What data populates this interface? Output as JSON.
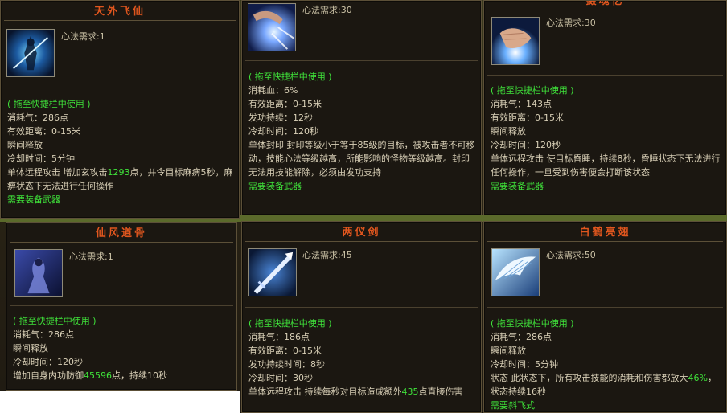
{
  "common": {
    "drag_hint": "( 拖至快捷栏中使用 )",
    "need_weapon": "需要装备武器"
  },
  "cards": [
    {
      "title": "天外飞仙",
      "req": "心法需求:1",
      "icon": "blue-sword-figure-icon",
      "lines": [
        "消耗气：286点",
        "有效距离：0-15米",
        "瞬间释放",
        "冷却时间：5分钟"
      ],
      "desc_pre": "单体远程攻击 增加玄攻击",
      "desc_num": "1293",
      "desc_post": "点，并令目标麻痹5秒，麻痹状态下无法进行任何操作",
      "footer": "需要装备武器"
    },
    {
      "title": "",
      "req": "心法需求:30",
      "icon": "glowing-hand-icon",
      "lines": [
        "消耗血：6%",
        "有效距离：0-15米",
        "发功持续：12秒",
        "冷却时间：120秒"
      ],
      "desc_pre": "单体封印 封印等级小于等于85级的目标，被攻击者不可移动，技能心法等级越高，所能影响的怪物等级越高。封印无法用技能解除，必须由发功支持",
      "desc_num": "",
      "desc_post": "",
      "footer": "需要装备武器"
    },
    {
      "title": "摄魂忆",
      "req": "心法需求:30",
      "icon": "palm-light-icon",
      "lines": [
        "消耗气：143点",
        "有效距离：0-15米",
        "瞬间释放",
        "冷却时间：120秒"
      ],
      "desc_pre": "单体远程攻击 使目标昏睡，持续8秒，昏睡状态下无法进行任何操作，一旦受到伤害便会打断该状态",
      "desc_num": "",
      "desc_post": "",
      "footer": "需要装备武器"
    },
    {
      "title": "仙风道骨",
      "req": "心法需求:1",
      "icon": "blue-robed-immortal-icon",
      "lines": [
        "消耗气：286点",
        "瞬间释放",
        "冷却时间：120秒"
      ],
      "desc_pre": "增加自身内功防御",
      "desc_num": "45596",
      "desc_post": "点，持续10秒",
      "footer": ""
    },
    {
      "title": "两仪剑",
      "req": "心法需求:45",
      "icon": "flying-sword-icon",
      "lines": [
        "消耗气：186点",
        "有效距离：0-15米",
        "发功持续时间：8秒",
        "冷却时间：30秒"
      ],
      "desc_pre": "单体远程攻击 持续每秒对目标造成额外",
      "desc_num": "435",
      "desc_post": "点直接伤害",
      "footer": ""
    },
    {
      "title": "白鹤亮翅",
      "req": "心法需求:50",
      "icon": "white-wing-icon",
      "lines": [
        "消耗气：286点",
        "瞬间释放",
        "冷却时间：5分钟"
      ],
      "desc_pre": "状态 此状态下，所有攻击技能的消耗和伤害都放大",
      "desc_num": "46%",
      "desc_post": "，状态持续16秒",
      "footer": "需要斜飞式"
    }
  ]
}
